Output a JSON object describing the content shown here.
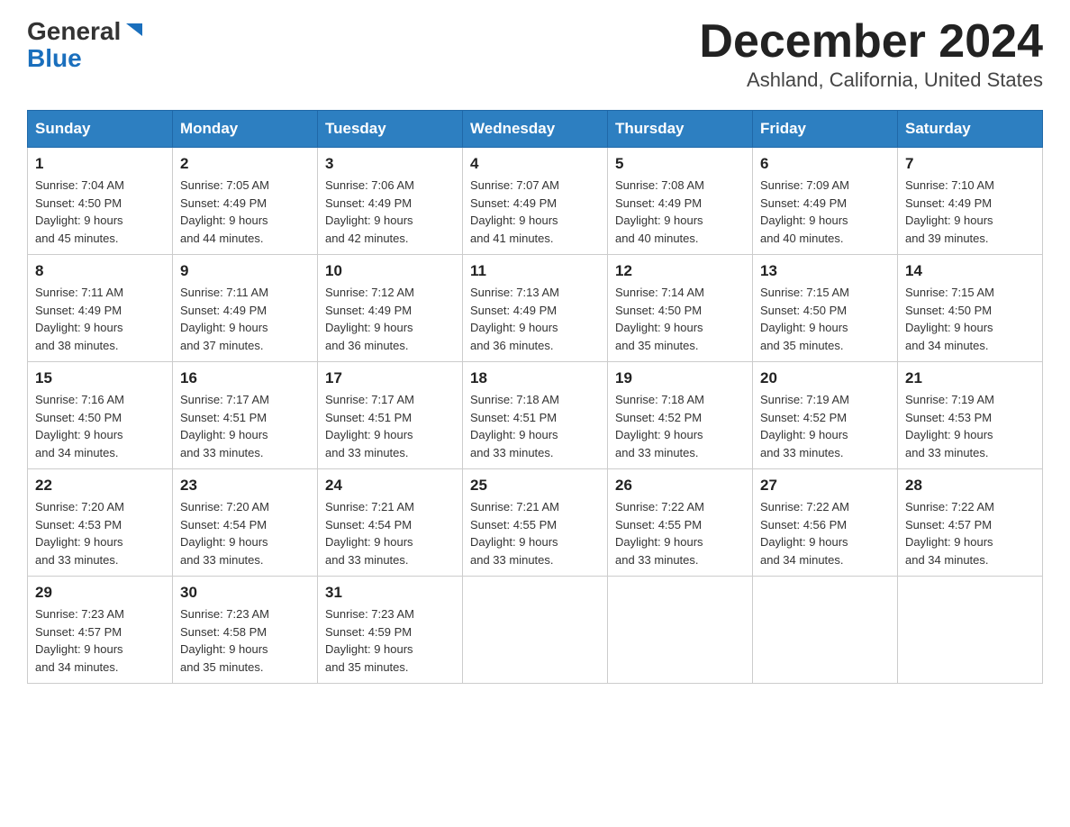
{
  "header": {
    "logo_line1": "General",
    "logo_line2": "Blue",
    "month_title": "December 2024",
    "subtitle": "Ashland, California, United States"
  },
  "days_of_week": [
    "Sunday",
    "Monday",
    "Tuesday",
    "Wednesday",
    "Thursday",
    "Friday",
    "Saturday"
  ],
  "weeks": [
    [
      {
        "day": "1",
        "sunrise": "7:04 AM",
        "sunset": "4:50 PM",
        "daylight": "9 hours and 45 minutes."
      },
      {
        "day": "2",
        "sunrise": "7:05 AM",
        "sunset": "4:49 PM",
        "daylight": "9 hours and 44 minutes."
      },
      {
        "day": "3",
        "sunrise": "7:06 AM",
        "sunset": "4:49 PM",
        "daylight": "9 hours and 42 minutes."
      },
      {
        "day": "4",
        "sunrise": "7:07 AM",
        "sunset": "4:49 PM",
        "daylight": "9 hours and 41 minutes."
      },
      {
        "day": "5",
        "sunrise": "7:08 AM",
        "sunset": "4:49 PM",
        "daylight": "9 hours and 40 minutes."
      },
      {
        "day": "6",
        "sunrise": "7:09 AM",
        "sunset": "4:49 PM",
        "daylight": "9 hours and 40 minutes."
      },
      {
        "day": "7",
        "sunrise": "7:10 AM",
        "sunset": "4:49 PM",
        "daylight": "9 hours and 39 minutes."
      }
    ],
    [
      {
        "day": "8",
        "sunrise": "7:11 AM",
        "sunset": "4:49 PM",
        "daylight": "9 hours and 38 minutes."
      },
      {
        "day": "9",
        "sunrise": "7:11 AM",
        "sunset": "4:49 PM",
        "daylight": "9 hours and 37 minutes."
      },
      {
        "day": "10",
        "sunrise": "7:12 AM",
        "sunset": "4:49 PM",
        "daylight": "9 hours and 36 minutes."
      },
      {
        "day": "11",
        "sunrise": "7:13 AM",
        "sunset": "4:49 PM",
        "daylight": "9 hours and 36 minutes."
      },
      {
        "day": "12",
        "sunrise": "7:14 AM",
        "sunset": "4:50 PM",
        "daylight": "9 hours and 35 minutes."
      },
      {
        "day": "13",
        "sunrise": "7:15 AM",
        "sunset": "4:50 PM",
        "daylight": "9 hours and 35 minutes."
      },
      {
        "day": "14",
        "sunrise": "7:15 AM",
        "sunset": "4:50 PM",
        "daylight": "9 hours and 34 minutes."
      }
    ],
    [
      {
        "day": "15",
        "sunrise": "7:16 AM",
        "sunset": "4:50 PM",
        "daylight": "9 hours and 34 minutes."
      },
      {
        "day": "16",
        "sunrise": "7:17 AM",
        "sunset": "4:51 PM",
        "daylight": "9 hours and 33 minutes."
      },
      {
        "day": "17",
        "sunrise": "7:17 AM",
        "sunset": "4:51 PM",
        "daylight": "9 hours and 33 minutes."
      },
      {
        "day": "18",
        "sunrise": "7:18 AM",
        "sunset": "4:51 PM",
        "daylight": "9 hours and 33 minutes."
      },
      {
        "day": "19",
        "sunrise": "7:18 AM",
        "sunset": "4:52 PM",
        "daylight": "9 hours and 33 minutes."
      },
      {
        "day": "20",
        "sunrise": "7:19 AM",
        "sunset": "4:52 PM",
        "daylight": "9 hours and 33 minutes."
      },
      {
        "day": "21",
        "sunrise": "7:19 AM",
        "sunset": "4:53 PM",
        "daylight": "9 hours and 33 minutes."
      }
    ],
    [
      {
        "day": "22",
        "sunrise": "7:20 AM",
        "sunset": "4:53 PM",
        "daylight": "9 hours and 33 minutes."
      },
      {
        "day": "23",
        "sunrise": "7:20 AM",
        "sunset": "4:54 PM",
        "daylight": "9 hours and 33 minutes."
      },
      {
        "day": "24",
        "sunrise": "7:21 AM",
        "sunset": "4:54 PM",
        "daylight": "9 hours and 33 minutes."
      },
      {
        "day": "25",
        "sunrise": "7:21 AM",
        "sunset": "4:55 PM",
        "daylight": "9 hours and 33 minutes."
      },
      {
        "day": "26",
        "sunrise": "7:22 AM",
        "sunset": "4:55 PM",
        "daylight": "9 hours and 33 minutes."
      },
      {
        "day": "27",
        "sunrise": "7:22 AM",
        "sunset": "4:56 PM",
        "daylight": "9 hours and 34 minutes."
      },
      {
        "day": "28",
        "sunrise": "7:22 AM",
        "sunset": "4:57 PM",
        "daylight": "9 hours and 34 minutes."
      }
    ],
    [
      {
        "day": "29",
        "sunrise": "7:23 AM",
        "sunset": "4:57 PM",
        "daylight": "9 hours and 34 minutes."
      },
      {
        "day": "30",
        "sunrise": "7:23 AM",
        "sunset": "4:58 PM",
        "daylight": "9 hours and 35 minutes."
      },
      {
        "day": "31",
        "sunrise": "7:23 AM",
        "sunset": "4:59 PM",
        "daylight": "9 hours and 35 minutes."
      },
      null,
      null,
      null,
      null
    ]
  ],
  "labels": {
    "sunrise": "Sunrise:",
    "sunset": "Sunset:",
    "daylight": "Daylight:"
  }
}
